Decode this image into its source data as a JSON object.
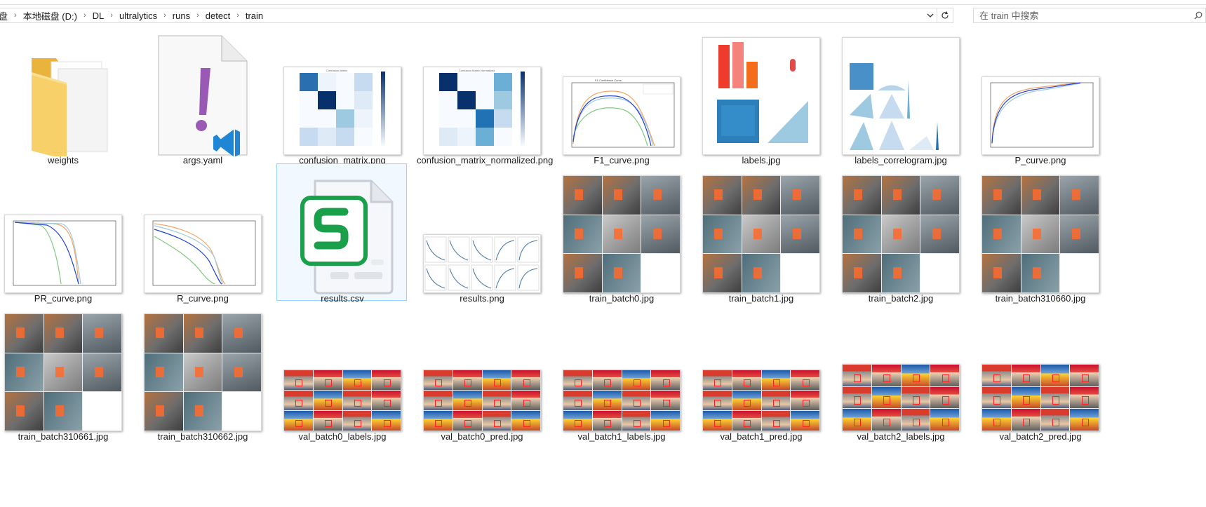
{
  "address_bar": {
    "crumbs": [
      "本地磁盘 (D:)",
      "DL",
      "ultralytics",
      "runs",
      "detect",
      "train"
    ],
    "first_fragment": "盘"
  },
  "search": {
    "placeholder": "在 train 中搜索"
  },
  "files": [
    {
      "name": "weights",
      "kind": "folder"
    },
    {
      "name": "args.yaml",
      "kind": "yaml"
    },
    {
      "name": "confusion_matrix.png",
      "kind": "confusion"
    },
    {
      "name": "confusion_matrix_normalized.png",
      "kind": "confusion"
    },
    {
      "name": "F1_curve.png",
      "kind": "curve"
    },
    {
      "name": "labels.jpg",
      "kind": "labels"
    },
    {
      "name": "labels_correlogram.jpg",
      "kind": "correlogram"
    },
    {
      "name": "P_curve.png",
      "kind": "curve"
    },
    {
      "name": "PR_curve.png",
      "kind": "curve"
    },
    {
      "name": "R_curve.png",
      "kind": "curve"
    },
    {
      "name": "results.csv",
      "kind": "csv",
      "selected": true
    },
    {
      "name": "results.png",
      "kind": "results"
    },
    {
      "name": "train_batch0.jpg",
      "kind": "mosaic"
    },
    {
      "name": "train_batch1.jpg",
      "kind": "mosaic"
    },
    {
      "name": "train_batch2.jpg",
      "kind": "mosaic"
    },
    {
      "name": "train_batch310660.jpg",
      "kind": "mosaic"
    },
    {
      "name": "train_batch310661.jpg",
      "kind": "mosaic"
    },
    {
      "name": "train_batch310662.jpg",
      "kind": "mosaic"
    },
    {
      "name": "val_batch0_labels.jpg",
      "kind": "valgrid"
    },
    {
      "name": "val_batch0_pred.jpg",
      "kind": "valgrid"
    },
    {
      "name": "val_batch1_labels.jpg",
      "kind": "valgrid"
    },
    {
      "name": "val_batch1_pred.jpg",
      "kind": "valgrid"
    },
    {
      "name": "val_batch2_labels.jpg",
      "kind": "valgrid"
    },
    {
      "name": "val_batch2_pred.jpg",
      "kind": "valgrid"
    }
  ],
  "colors": {
    "selection_border": "#99d1ff",
    "selection_fill": "#f2f8ff",
    "folder": "#f5c94c",
    "yaml_exclaim": "#9b59b6",
    "vscode_blue": "#1f86d6",
    "csv_green": "#1aa04b",
    "heat_dark": "#08306b"
  }
}
